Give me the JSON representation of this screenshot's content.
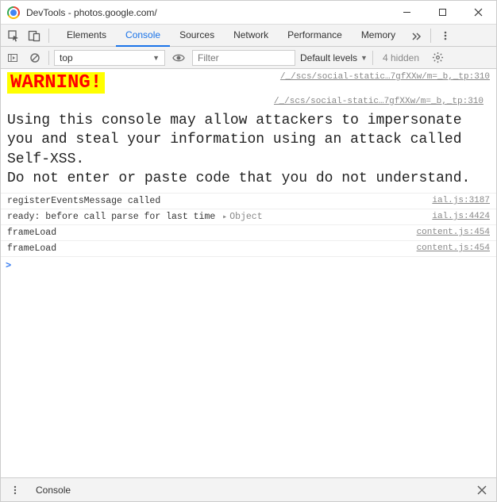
{
  "window": {
    "title": "DevTools - photos.google.com/"
  },
  "tabs": {
    "items": [
      "Elements",
      "Console",
      "Sources",
      "Network",
      "Performance",
      "Memory"
    ],
    "active_index": 1
  },
  "console_toolbar": {
    "context": "top",
    "filter_placeholder": "Filter",
    "levels_label": "Default levels",
    "hidden_label": "4 hidden"
  },
  "console": {
    "warning_title": "WARNING!",
    "warning_src1": "/_/scs/social-static…7gfXXw/m=_b,_tp:310",
    "warning_src2": "/_/scs/social-static…7gfXXw/m=_b,_tp:310",
    "warning_body_line1": "Using this console may allow attackers to impersonate you and steal your information using an attack called Self-XSS.",
    "warning_body_line2": "Do not enter or paste code that you do not understand.",
    "rows": [
      {
        "text": "registerEventsMessage called",
        "obj": false,
        "src": "ial.js:3187"
      },
      {
        "text": "ready: before call parse for last time",
        "obj": true,
        "obj_label": "Object",
        "src": "ial.js:4424"
      },
      {
        "text": "frameLoad",
        "obj": false,
        "src": "content.js:454"
      },
      {
        "text": "frameLoad",
        "obj": false,
        "src": "content.js:454"
      }
    ],
    "prompt": ">"
  },
  "drawer": {
    "tab": "Console"
  }
}
